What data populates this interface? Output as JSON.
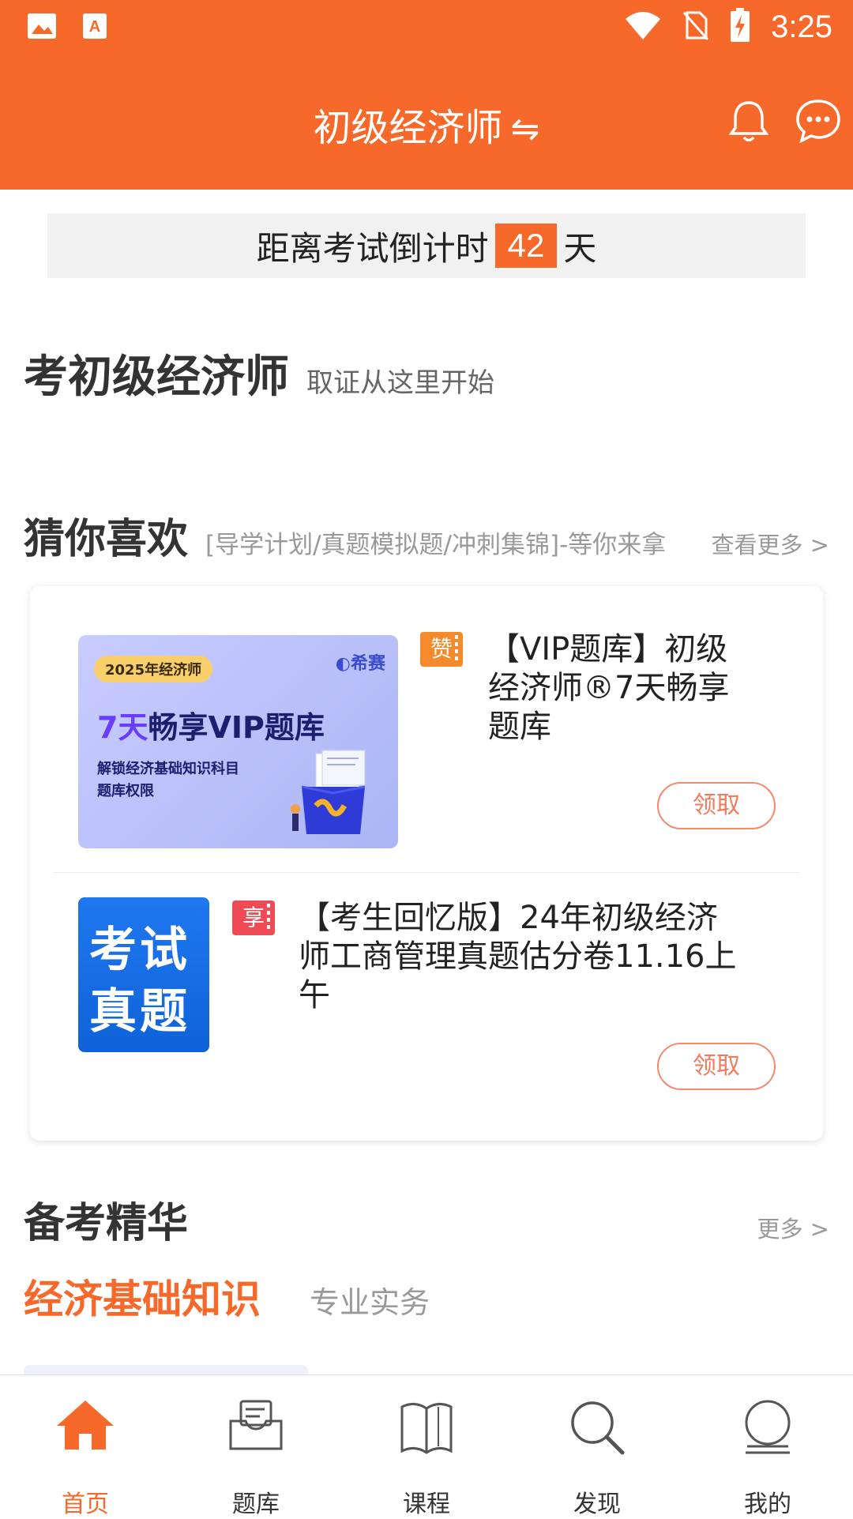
{
  "status_bar": {
    "time": "3:25"
  },
  "header": {
    "title": "初级经济师",
    "swap_symbol": "⇋"
  },
  "countdown": {
    "prefix": "距离考试倒计时",
    "days": "42",
    "suffix": "天"
  },
  "headline": {
    "title": "考初级经济师",
    "subtitle": "取证从这里开始"
  },
  "guess": {
    "title": "猜你喜欢",
    "desc": "[导学计划/真题模拟题/冲刺集锦]-等你来拿",
    "more": "查看更多 >",
    "items": [
      {
        "tag": "赞",
        "title_lines": [
          "【VIP题库】初级",
          "经济师®7天畅享",
          "题库"
        ],
        "button": "领取",
        "thumb": {
          "year": "2025年经济师",
          "logo": "希赛",
          "big_highlight": "7天",
          "big_rest": "畅享VIP题库",
          "small1": "解锁经济基础知识科目",
          "small2": "题库权限"
        }
      },
      {
        "tag": "享",
        "title_lines": [
          "【考生回忆版】24年初级经济",
          "师工商管理真题估分卷11.16上",
          "午"
        ],
        "button": "领取",
        "thumb": {
          "line1": "考试",
          "line2": "真题"
        }
      }
    ]
  },
  "essentials": {
    "title": "备考精华",
    "more": "更多 >",
    "tabs": [
      "经济基础知识",
      "专业实务"
    ]
  },
  "bottom_nav": [
    {
      "label": "首页",
      "icon": "home-icon",
      "active": true
    },
    {
      "label": "题库",
      "icon": "question-bank-icon",
      "active": false
    },
    {
      "label": "课程",
      "icon": "book-icon",
      "active": false
    },
    {
      "label": "发现",
      "icon": "search-icon",
      "active": false
    },
    {
      "label": "我的",
      "icon": "profile-icon",
      "active": false
    }
  ],
  "colors": {
    "brand": "#f7692a",
    "tag_zan": "#f58a2c",
    "tag_xiang": "#ef4b56",
    "thumb2_bg": "#1f78f0"
  }
}
